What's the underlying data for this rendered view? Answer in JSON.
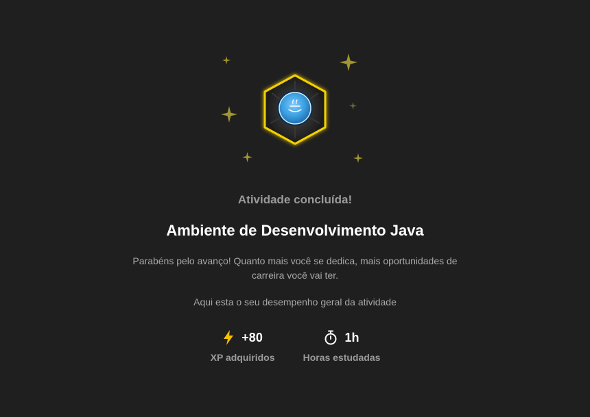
{
  "status_text": "Atividade concluída!",
  "title": "Ambiente de Desenvolvimento Java",
  "message": "Parabéns pelo avanço! Quanto mais você se dedica, mais oportunidades de carreira você vai ter.",
  "performance_text": "Aqui esta o seu desempenho geral da atividade",
  "stats": [
    {
      "icon": "lightning-icon",
      "value": "+80",
      "label": "XP adquiridos"
    },
    {
      "icon": "stopwatch-icon",
      "value": "1h",
      "label": "Horas estudadas"
    }
  ],
  "colors": {
    "background": "#1f1f1f",
    "accent_yellow": "#f5d000",
    "sparkle": "#a09530",
    "badge_blue": "#3a9fe0"
  }
}
